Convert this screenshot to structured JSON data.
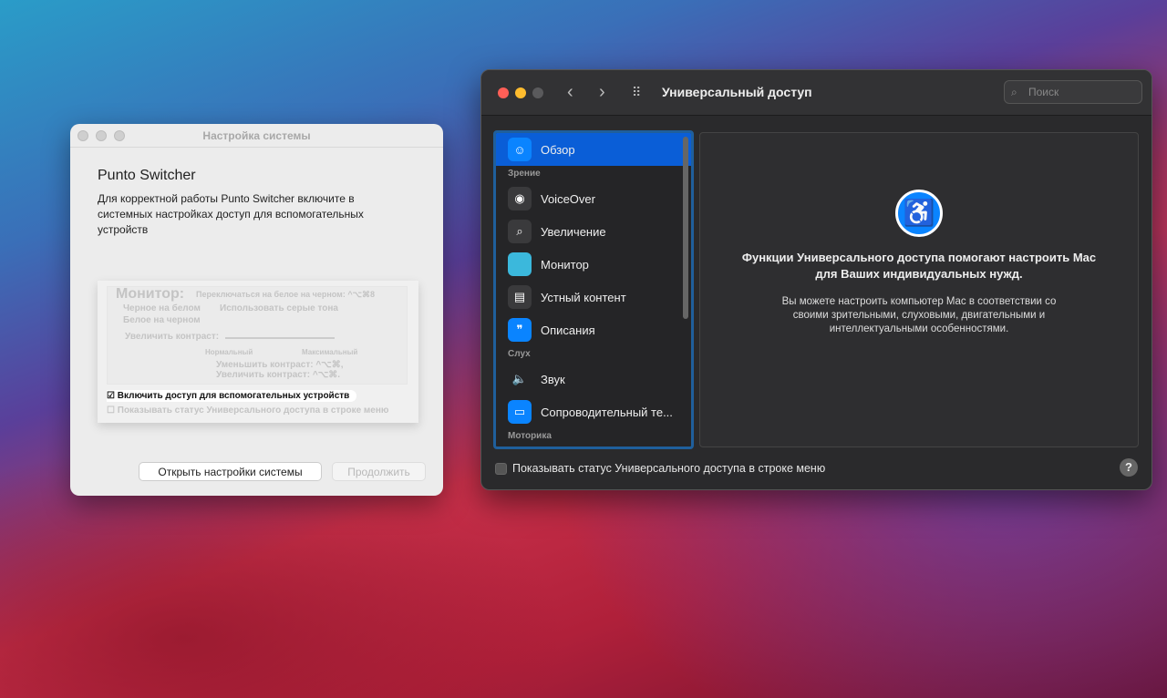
{
  "dialog": {
    "title": "Настройка системы",
    "heading": "Punto Switcher",
    "text": "Для корректной работы Punto Switcher включите в системных настройках доступ для вспомогательных устройств",
    "preview": {
      "monitor": "Монитор:",
      "switch": "Переключаться на белое на черном: ^⌥⌘8",
      "black_on_white": "Черное на белом",
      "grayscale": "Использовать серые тона",
      "white_on_black": "Белое на черном",
      "contrast": "Увеличить контраст:",
      "normal": "Нормальный",
      "max": "Максимальный",
      "decrease": "Уменьшить контраст: ^⌥⌘,",
      "increase": "Увеличить контраст: ^⌥⌘.",
      "enable": "Включить доступ для вспомогательных устройств",
      "show_status": "Показывать статус Универсального доступа в строке меню"
    },
    "open_button": "Открыть настройки системы",
    "continue_button": "Продолжить"
  },
  "prefs": {
    "title": "Универсальный доступ",
    "search_placeholder": "Поиск",
    "sidebar": [
      {
        "type": "item",
        "label": "Обзор",
        "icon": "accessibility-icon",
        "selected": true
      },
      {
        "type": "section",
        "label": "Зрение"
      },
      {
        "type": "item",
        "label": "VoiceOver",
        "icon": "voiceover-icon"
      },
      {
        "type": "item",
        "label": "Увеличение",
        "icon": "zoom-icon"
      },
      {
        "type": "item",
        "label": "Монитор",
        "icon": "display-icon"
      },
      {
        "type": "item",
        "label": "Устный контент",
        "icon": "spoken-content-icon"
      },
      {
        "type": "item",
        "label": "Описания",
        "icon": "descriptions-icon"
      },
      {
        "type": "section",
        "label": "Слух"
      },
      {
        "type": "item",
        "label": "Звук",
        "icon": "speaker-icon"
      },
      {
        "type": "item",
        "label": "Сопроводительный те...",
        "icon": "captions-icon"
      },
      {
        "type": "section",
        "label": "Моторика"
      }
    ],
    "heading": "Функции Универсального доступа помогают настроить Mac для Ваших индивидуальных нужд.",
    "text": "Вы можете настроить компьютер Mac в соответствии со своими зрительными, слуховыми, двигательными и интеллектуальными особенностями.",
    "show_status": "Показывать статус Универсального доступа в строке меню",
    "help": "?"
  }
}
